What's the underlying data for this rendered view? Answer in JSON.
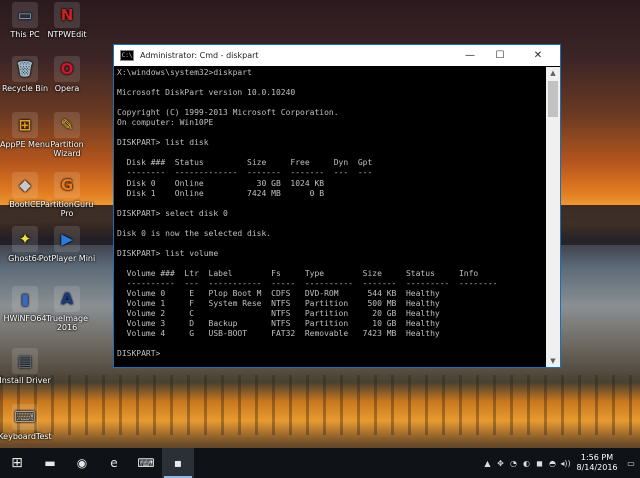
{
  "desktop": {
    "icons": [
      {
        "label": "This PC",
        "glyph": "▭",
        "color": "#7fb0e0"
      },
      {
        "label": "NTPWEdit",
        "glyph": "N",
        "color": "#d21e1e"
      },
      {
        "label": "Recycle Bin",
        "glyph": "🗑",
        "color": "#9fb8c8"
      },
      {
        "label": "Opera",
        "glyph": "O",
        "color": "#d8142a"
      },
      {
        "label": "AppPE Menu",
        "glyph": "⊞",
        "color": "#e8a020"
      },
      {
        "label": "Partition Wizard",
        "glyph": "✎",
        "color": "#f0c030"
      },
      {
        "label": "BootICE",
        "glyph": "◆",
        "color": "#c8c8c8"
      },
      {
        "label": "PartitionGuru Pro",
        "glyph": "G",
        "color": "#f07818"
      },
      {
        "label": "Ghost64",
        "glyph": "✦",
        "color": "#f0e040"
      },
      {
        "label": "PotPlayer Mini",
        "glyph": "▶",
        "color": "#2a7ae0"
      },
      {
        "label": "HWiNFO64",
        "glyph": "▮",
        "color": "#3a6ac0"
      },
      {
        "label": "TrueImage 2016",
        "glyph": "A",
        "color": "#1a3a8a"
      },
      {
        "label": "Install Driver",
        "glyph": "▤",
        "color": "#607080"
      },
      {
        "label": "KeyboardTest",
        "glyph": "⌨",
        "color": "#a0a0a0"
      }
    ]
  },
  "window": {
    "title": "Administrator: Cmd - diskpart",
    "icon_label": "C:\\",
    "minimize": "—",
    "maximize": "☐",
    "close": "✕",
    "console_lines": [
      "X:\\windows\\system32>diskpart",
      "",
      "Microsoft DiskPart version 10.0.10240",
      "",
      "Copyright (C) 1999-2013 Microsoft Corporation.",
      "On computer: Win10PE",
      "",
      "DISKPART> list disk",
      "",
      "  Disk ###  Status         Size     Free     Dyn  Gpt",
      "  --------  -------------  -------  -------  ---  ---",
      "  Disk 0    Online           30 GB  1024 KB",
      "  Disk 1    Online         7424 MB      0 B",
      "",
      "DISKPART> select disk 0",
      "",
      "Disk 0 is now the selected disk.",
      "",
      "DISKPART> list volume",
      "",
      "  Volume ###  Ltr  Label        Fs     Type        Size     Status     Info",
      "  ----------  ---  -----------  -----  ----------  -------  ---------  --------",
      "  Volume 0     E   Plop Boot M  CDFS   DVD-ROM      544 KB  Healthy",
      "  Volume 1     F   System Rese  NTFS   Partition    500 MB  Healthy",
      "  Volume 2     C                NTFS   Partition     20 GB  Healthy",
      "  Volume 3     D   Backup       NTFS   Partition     10 GB  Healthy",
      "  Volume 4     G   USB-BOOT     FAT32  Removable   7423 MB  Healthy",
      "",
      "DISKPART> "
    ]
  },
  "taskbar": {
    "start": "⊞",
    "items": [
      {
        "name": "file-explorer",
        "glyph": "▬"
      },
      {
        "name": "network",
        "glyph": "◉"
      },
      {
        "name": "internet-explorer",
        "glyph": "e"
      },
      {
        "name": "keyboard",
        "glyph": "⌨"
      },
      {
        "name": "cmd",
        "glyph": "▪"
      }
    ],
    "tray_icons": [
      "▲",
      "✥",
      "◔",
      "◐",
      "◼",
      "◓",
      "◂))"
    ],
    "time": "1:56 PM",
    "date": "8/14/2016",
    "notifications": "▭"
  }
}
